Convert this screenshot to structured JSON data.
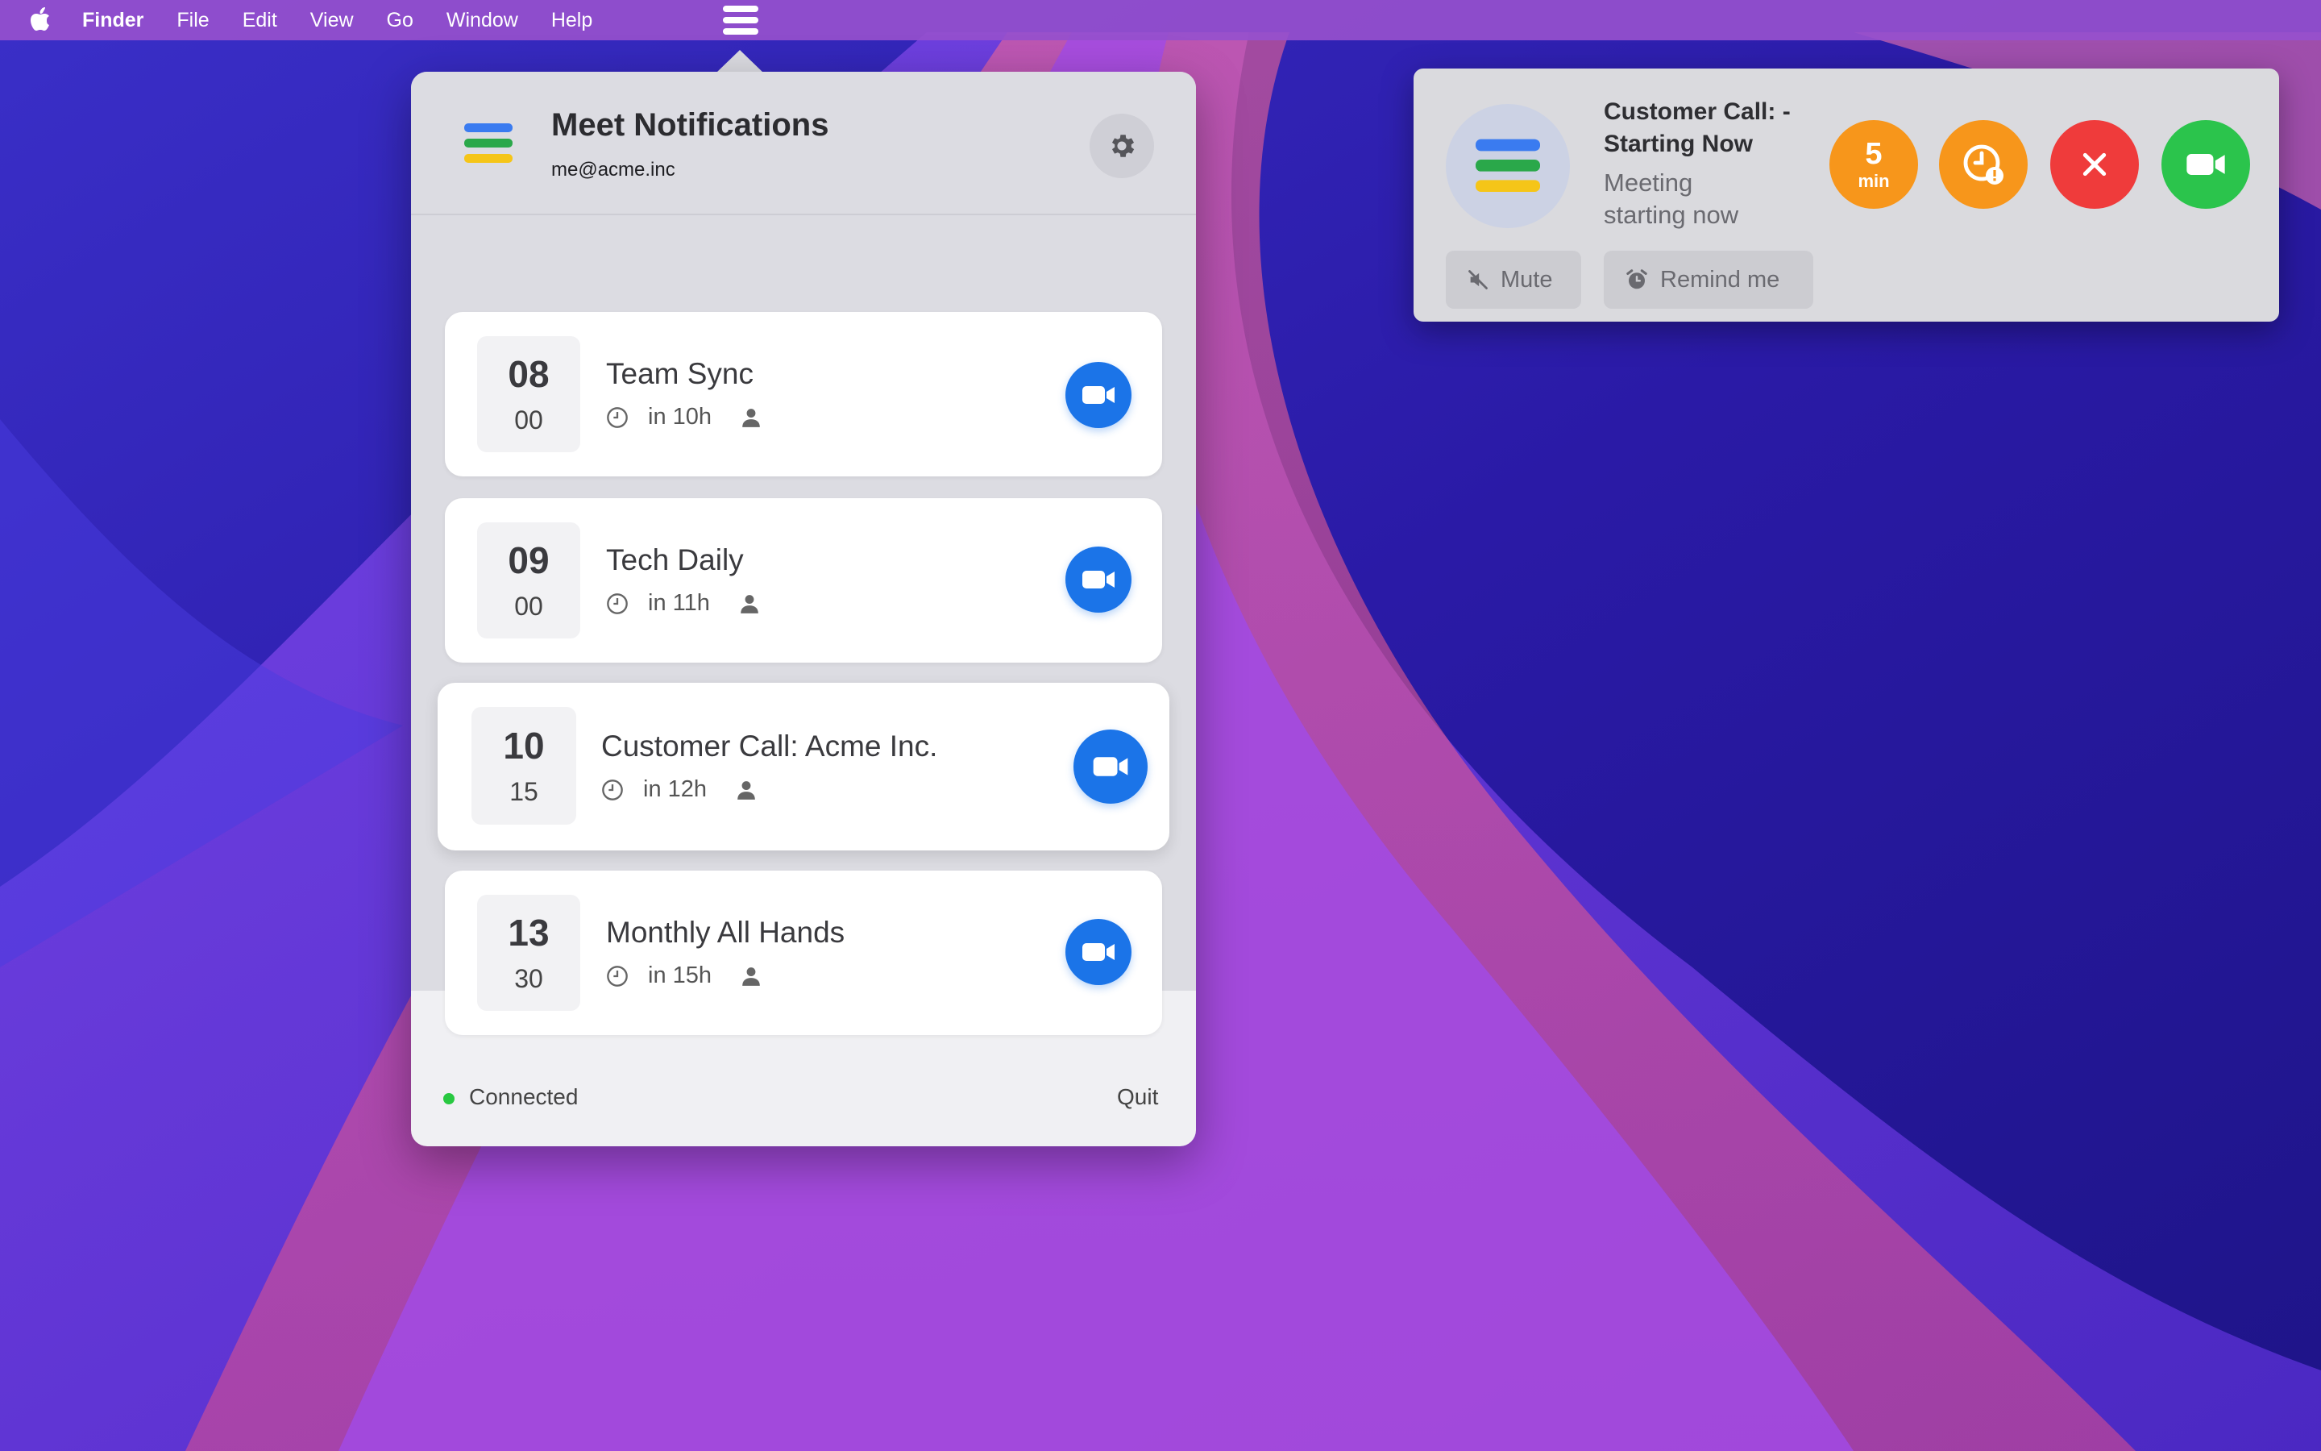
{
  "menubar": {
    "app_name": "Finder",
    "items": [
      "File",
      "Edit",
      "View",
      "Go",
      "Window",
      "Help"
    ],
    "icons": [
      "apple-icon",
      "tray-hamburger-icon"
    ]
  },
  "popover": {
    "title": "Meet Notifications",
    "email": "me@acme.inc",
    "meetings": [
      {
        "hour": "08",
        "minute": "00",
        "title": "Team Sync",
        "relative": "in 10h"
      },
      {
        "hour": "09",
        "minute": "00",
        "title": "Tech Daily",
        "relative": "in 11h"
      },
      {
        "hour": "10",
        "minute": "15",
        "title": "Customer Call: Acme Inc.",
        "relative": "in 12h"
      },
      {
        "hour": "13",
        "minute": "30",
        "title": "Monthly All Hands",
        "relative": "in 15h"
      }
    ],
    "footer": {
      "status": "Connected",
      "quit": "Quit"
    }
  },
  "notification": {
    "title": "Customer Call: - Starting Now",
    "subtitle": "Meeting starting now",
    "snooze_value": "5",
    "snooze_unit": "min",
    "mute_label": "Mute",
    "remind_label": "Remind me"
  },
  "colors": {
    "accent_blue": "#1b74e8",
    "snooze_orange": "#f7961b",
    "dismiss_red": "#ef3b3b",
    "join_green": "#2bc44c",
    "connected_green": "#28c840",
    "logo_blue": "#3a7bf0",
    "logo_green": "#2aa84a",
    "logo_yellow": "#f5c518"
  }
}
